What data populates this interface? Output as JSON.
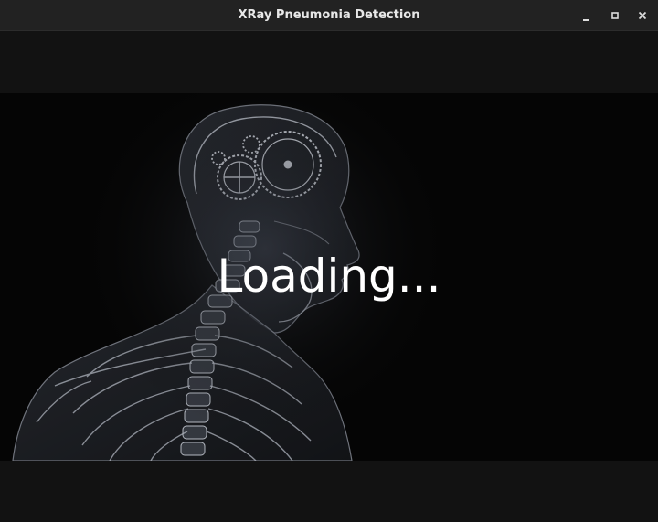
{
  "window": {
    "title": "XRay Pneumonia Detection",
    "controls": [
      "minimize-icon",
      "maximize-icon",
      "close-icon"
    ]
  },
  "splash": {
    "loading_text": "Loading..."
  },
  "colors": {
    "titlebar": "#222222",
    "band": "#121212",
    "background": "#050505",
    "text": "#ffffff"
  }
}
